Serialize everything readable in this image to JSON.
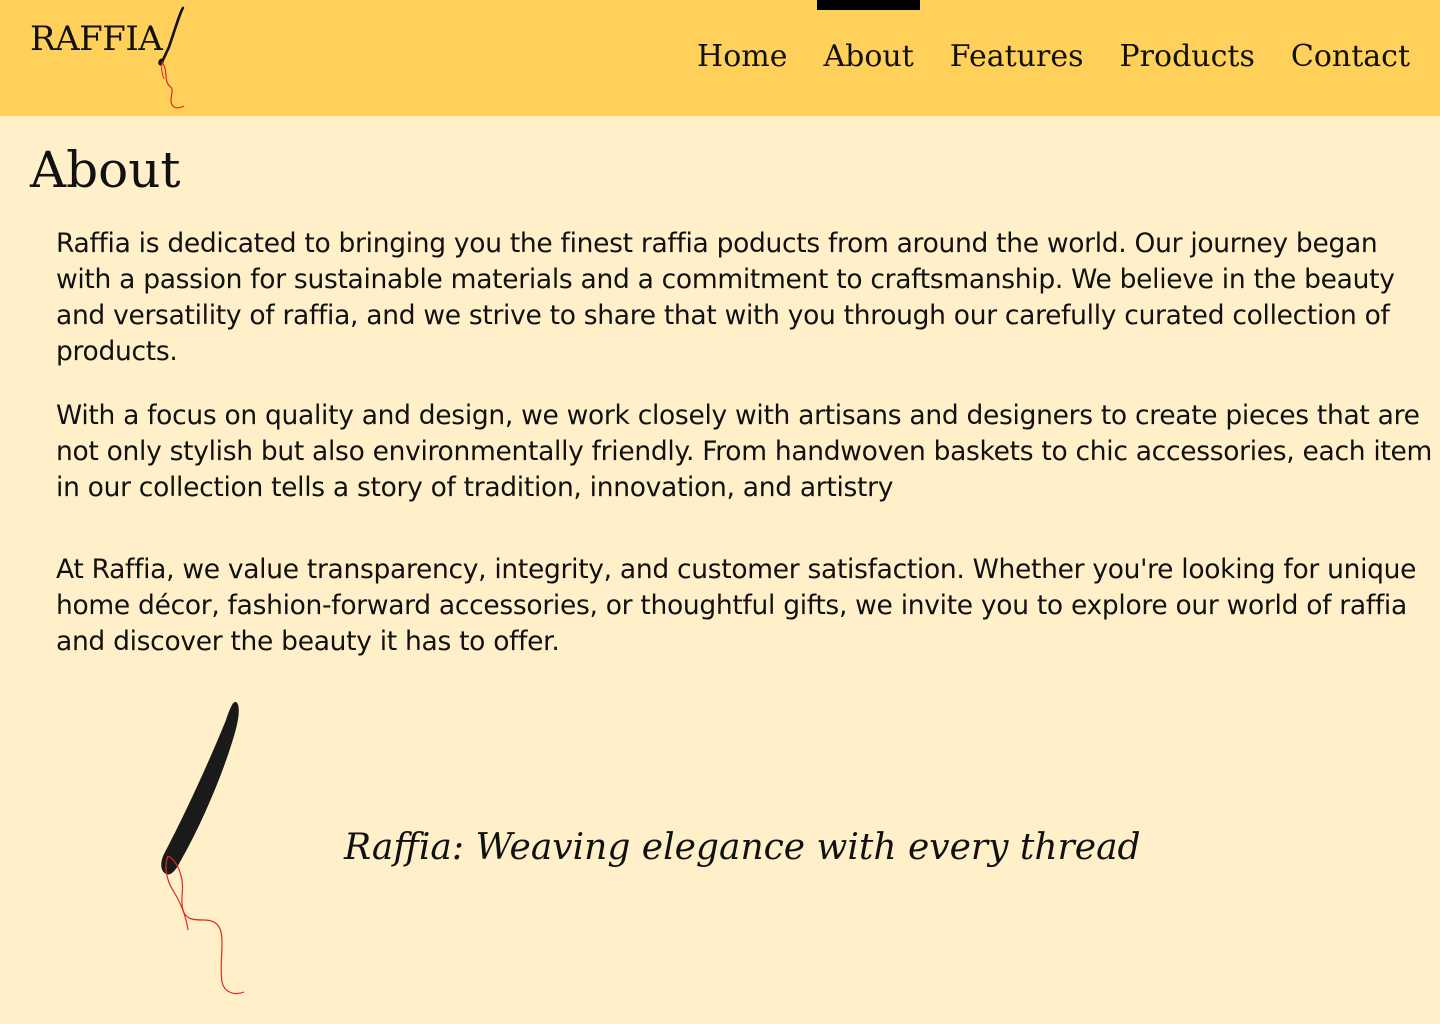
{
  "brand": {
    "name": "RAFFIA",
    "icon": "needle-thread-icon",
    "colors": {
      "header_bg": "#FFD05A",
      "page_bg": "#FFF0C9",
      "text": "#111111",
      "thread": "#E02A1F",
      "active_indicator": "#000000"
    }
  },
  "nav": {
    "items": [
      {
        "label": "Home",
        "active": false
      },
      {
        "label": "About",
        "active": true
      },
      {
        "label": "Features",
        "active": false
      },
      {
        "label": "Products",
        "active": false
      },
      {
        "label": "Contact",
        "active": false
      }
    ]
  },
  "page": {
    "title": "About",
    "paragraphs": [
      "Raffia is dedicated to bringing you the finest raffia poducts from around the world. Our journey began with a passion for sustainable materials and a commitment to craftsmanship. We believe in the beauty and versatility of raffia, and we strive to share that with you through our carefully curated collection of products.",
      "With a focus on quality and design, we work closely with artisans and designers to create pieces that are not only stylish but also environmentally friendly. From handwoven baskets to chic accessories, each item in our collection tells a story of tradition, innovation, and artistry",
      "At Raffia, we value transparency, integrity, and customer satisfaction. Whether you're looking for unique home décor, fashion-forward accessories, or thoughtful gifts, we invite you to explore our world of raffia and discover the beauty it has to offer."
    ],
    "tagline": "Raffia: Weaving elegance with every thread",
    "tagline_icon": "needle-thread-icon"
  }
}
